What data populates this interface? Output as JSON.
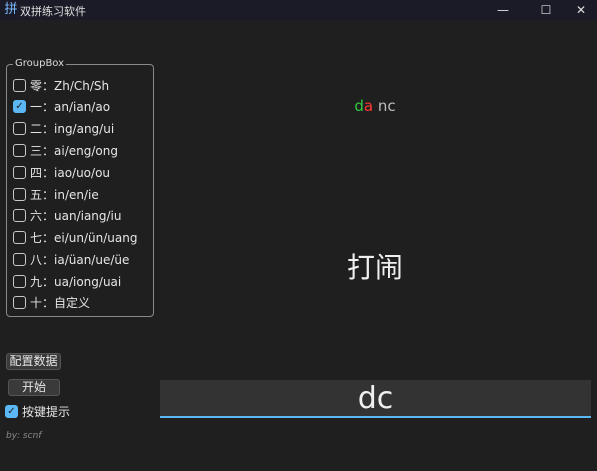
{
  "window": {
    "title": "双拼练习软件",
    "icon": "pinyin-app-icon"
  },
  "controls": {
    "minimize": "—",
    "maximize": "☐",
    "close": "✕"
  },
  "groupbox": {
    "title": "GroupBox",
    "options": [
      {
        "label": "零：Zh/Ch/Sh",
        "checked": false
      },
      {
        "label": "一：an/ian/ao",
        "checked": true
      },
      {
        "label": "二：ing/ang/ui",
        "checked": false
      },
      {
        "label": "三：ai/eng/ong",
        "checked": false
      },
      {
        "label": "四：iao/uo/ou",
        "checked": false
      },
      {
        "label": "五：in/en/ie",
        "checked": false
      },
      {
        "label": "六：uan/iang/iu",
        "checked": false
      },
      {
        "label": "七：ei/un/ün/uang",
        "checked": false
      },
      {
        "label": "八：ia/üan/ue/üe",
        "checked": false
      },
      {
        "label": "九：ua/iong/uai",
        "checked": false
      },
      {
        "label": "十：自定义",
        "checked": false
      }
    ]
  },
  "buttons": {
    "config": "配置数据",
    "start": "开始"
  },
  "key_hint": {
    "label": "按键提示",
    "checked": true
  },
  "byline": "by: scnf",
  "practice": {
    "hint_correct": "d",
    "hint_wrong": "a",
    "hint_rest": " nc",
    "word": "打闹",
    "input_value": "dc"
  },
  "colors": {
    "accent": "#5bb8f5",
    "correct": "#2ecc40",
    "wrong": "#ff3b30"
  }
}
